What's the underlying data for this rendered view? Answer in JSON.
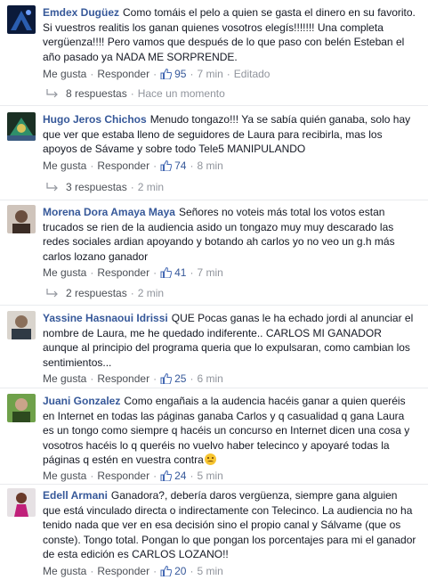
{
  "comments": [
    {
      "author": "Emdex Dugüez",
      "text": "Como tomáis el pelo a quien se gasta el dinero en su favorito. Si vuestros realitis los ganan quienes vosotros elegís!!!!!!! Una completa vergüenza!!!! Pero vamos que después de lo que paso con belén Esteban el año pasado ya NADA ME SORPRENDE.",
      "like": "Me gusta",
      "reply": "Responder",
      "count": "95",
      "time": "7 min",
      "edited": "Editado",
      "replies_label": "8 respuestas",
      "replies_time": "Hace un momento",
      "avatar_color": "#1c3d7a"
    },
    {
      "author": "Hugo Jeros Chichos",
      "text": "Menudo tongazo!!! Ya se sabía quién ganaba, solo hay que ver que estaba lleno de seguidores de Laura para recibirla, mas los apoyos de Sávame y sobre todo Tele5 MANIPULANDO",
      "like": "Me gusta",
      "reply": "Responder",
      "count": "74",
      "time": "8 min",
      "replies_label": "3 respuestas",
      "replies_time": "2 min",
      "avatar_color": "#3a7a5a"
    },
    {
      "author": "Morena Dora Amaya Maya",
      "text": "Señores no voteis más total los votos estan trucados se rien de la audiencia asido un tongazo muy muy descarado las redes sociales ardian apoyando y botando ah carlos yo no veo un g.h más carlos lozano ganador",
      "like": "Me gusta",
      "reply": "Responder",
      "count": "41",
      "time": "7 min",
      "replies_label": "2 respuestas",
      "replies_time": "2 min",
      "avatar_color": "#6b5a50"
    },
    {
      "author": "Yassine Hasnaoui Idrissi",
      "text": "QUE Pocas ganas le ha echado jordi al anunciar el nombre de Laura, me he quedado indiferente.. CARLOS MI GANADOR aunque al principio del programa queria que lo expulsaran, como cambian los sentimientos...",
      "like": "Me gusta",
      "reply": "Responder",
      "count": "25",
      "time": "6 min",
      "avatar_color": "#7a6f64"
    },
    {
      "author": "Juani Gonzalez",
      "text": "Como engañais a la audencia hacéis ganar a quien queréis en Internet en todas las páginas ganaba Carlos y q casualidad q gana Laura es un tongo como siempre q hacéis un concurso en Internet dicen una cosa y vosotros hacéis lo q queréis no vuelvo haber telecinco y apoyaré todas la páginas q estén en vuestra contra",
      "like": "Me gusta",
      "reply": "Responder",
      "count": "24",
      "time": "5 min",
      "avatar_color": "#4f8a3a"
    },
    {
      "author": "Edell Armani",
      "text": "Ganadora?, debería daros vergüenza, siempre gana alguien que está vinculado directa o indirectamente con Telecinco. La audiencia no ha tenido nada que ver en esa decisión sino el propio canal y Sálvame (que os conste). Tongo total. Pongan lo que pongan los porcentajes para mi el ganador de esta edición es CARLOS LOZANO!!",
      "like": "Me gusta",
      "reply": "Responder",
      "count": "20",
      "time": "5 min",
      "avatar_color": "#8a2a6a"
    }
  ]
}
